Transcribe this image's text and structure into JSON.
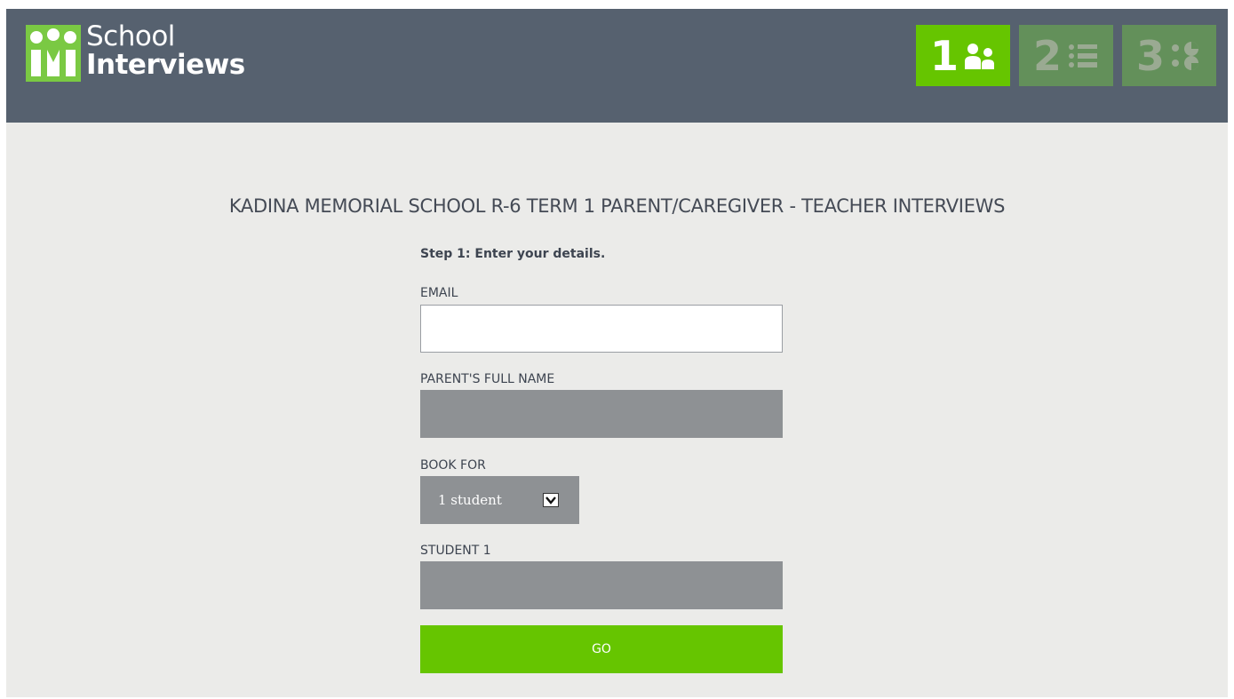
{
  "brand": {
    "line1": "School",
    "line2": "Interviews",
    "logo_icon": "people-logo-icon"
  },
  "steps": [
    {
      "number": "1",
      "icon": "people-icon",
      "active": true
    },
    {
      "number": "2",
      "icon": "list-icon",
      "active": false
    },
    {
      "number": "3",
      "icon": "pie-chart-icon",
      "active": false
    }
  ],
  "colors": {
    "header_bg": "#56616f",
    "accent_green": "#66c500",
    "step_inactive": "#63905a",
    "field_grey": "#8e9194",
    "page_bg": "#ebebe9"
  },
  "page_title": "KADINA MEMORIAL SCHOOL R-6 TERM 1 PARENT/CAREGIVER - TEACHER INTERVIEWS",
  "form": {
    "step_caption": "Step 1: Enter your details.",
    "email": {
      "label": "EMAIL",
      "value": ""
    },
    "parent_name": {
      "label": "PARENT'S FULL NAME",
      "value": ""
    },
    "book_for": {
      "label": "BOOK FOR",
      "selected": "1 student"
    },
    "student1": {
      "label": "STUDENT 1",
      "value": ""
    },
    "submit_label": "GO"
  }
}
